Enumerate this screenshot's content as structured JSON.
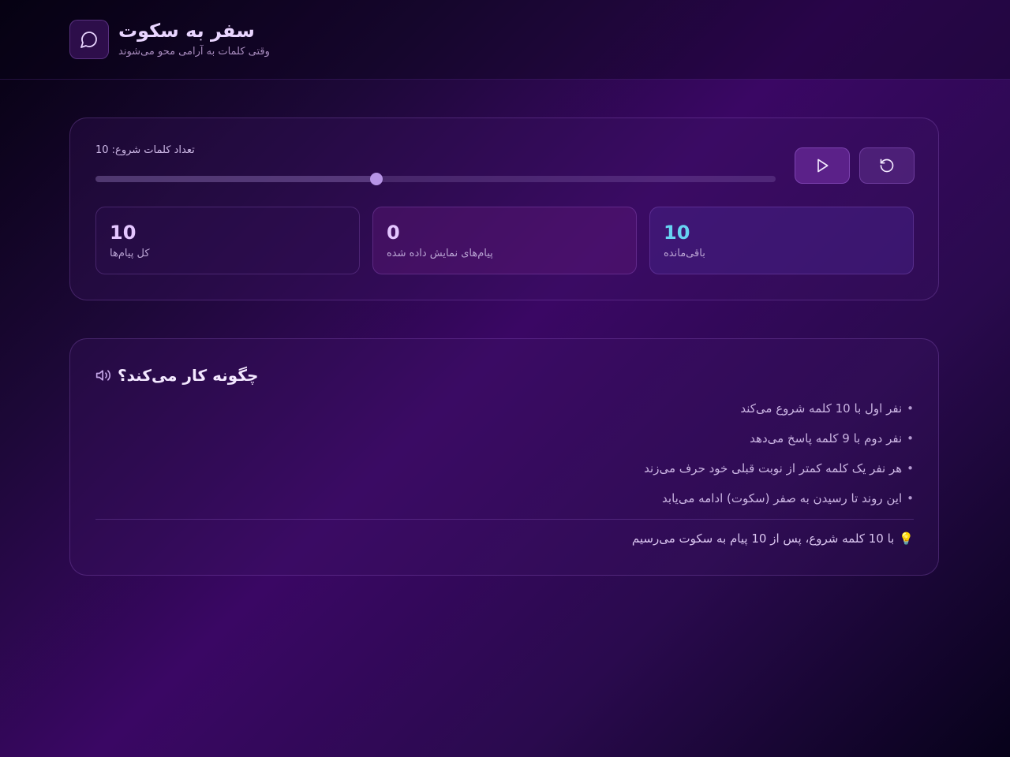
{
  "header": {
    "title": "سفر به سکوت",
    "subtitle": "وقتی کلمات به آرامی محو می‌شوند",
    "logo_icon": "chat-bubble-icon"
  },
  "controls": {
    "slider_label": "تعداد کلمات شروع: 10",
    "slider_value": 10,
    "slider_fraction": 0.413,
    "play_icon": "play-icon",
    "reset_icon": "reset-icon"
  },
  "stats": {
    "total": {
      "value": "10",
      "label": "کل پیام‌ها"
    },
    "shown": {
      "value": "0",
      "label": "پیام‌های نمایش داده شده"
    },
    "remaining": {
      "value": "10",
      "label": "باقی‌مانده"
    }
  },
  "info": {
    "title": "چگونه کار می‌کند؟",
    "title_icon": "speaker-icon",
    "bullet": "•",
    "steps": [
      "نفر اول با 10 کلمه شروع می‌کند",
      "نفر دوم با 9 کلمه پاسخ می‌دهد",
      "هر نفر یک کلمه کمتر از نوبت قبلی خود حرف می‌زند",
      "این روند تا رسیدن به صفر (سکوت) ادامه می‌یابد"
    ],
    "summary_icon": "💡",
    "summary": "با 10 کلمه شروع، پس از 10 پیام به سکوت می‌رسیم"
  },
  "colors": {
    "accent": "#5b2189",
    "remaining_value": "#67d3f2",
    "text_primary": "#e9d5ff"
  }
}
